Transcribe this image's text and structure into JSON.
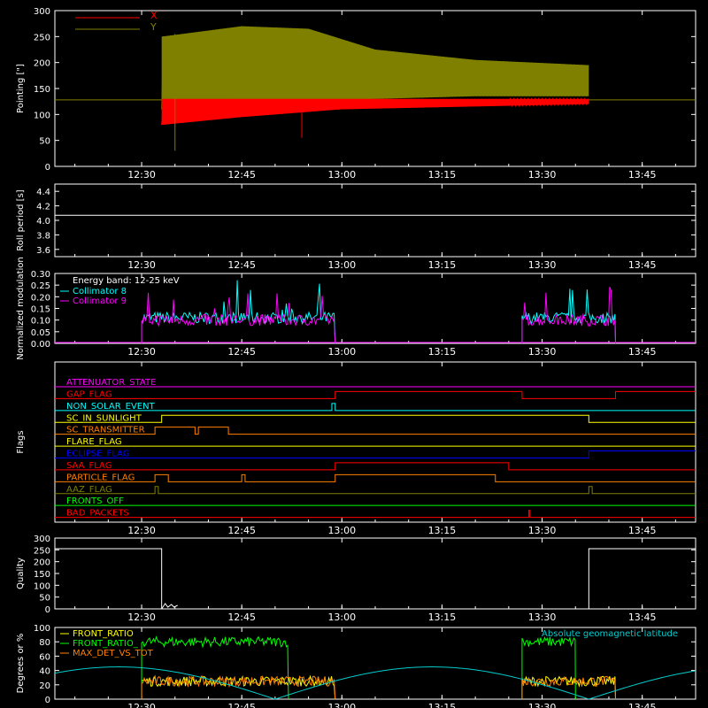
{
  "time_ticks": [
    "12:30",
    "12:45",
    "13:00",
    "13:15",
    "13:30",
    "13:45"
  ],
  "chart_data": [
    {
      "type": "line",
      "ylabel": "Pointing [\"]",
      "ylim": [
        0,
        300
      ],
      "yticks": [
        "0",
        "50",
        "100",
        "150",
        "200",
        "250",
        "300"
      ],
      "series": [
        {
          "name": "X",
          "color": "#ff0000",
          "data": [
            [
              "12:33",
              95
            ],
            [
              "12:45",
              110
            ],
            [
              "12:57",
              115
            ],
            [
              "13:10",
              125
            ],
            [
              "13:25",
              130
            ],
            [
              "13:37",
              130
            ]
          ],
          "band": [
            [
              "12:33",
              80,
              130
            ],
            [
              "12:45",
              95,
              130
            ],
            [
              "13:00",
              110,
              130
            ],
            [
              "13:37",
              120,
              130
            ]
          ]
        },
        {
          "name": "Y",
          "color": "#808000",
          "data": [
            [
              "12:33",
              180
            ],
            [
              "12:45",
              200
            ],
            [
              "12:57",
              195
            ],
            [
              "13:10",
              170
            ],
            [
              "13:25",
              160
            ],
            [
              "13:37",
              160
            ]
          ],
          "band": [
            [
              "12:33",
              110,
              250
            ],
            [
              "12:45",
              120,
              270
            ],
            [
              "12:55",
              125,
              265
            ],
            [
              "13:05",
              130,
              225
            ],
            [
              "13:20",
              135,
              205
            ],
            [
              "13:37",
              135,
              195
            ]
          ]
        }
      ],
      "reference_line": 128,
      "legend": "top-left"
    },
    {
      "type": "line",
      "ylabel": "Roll period [s]",
      "ylim": [
        3.5,
        4.5
      ],
      "yticks": [
        "3.6",
        "3.8",
        "4.0",
        "4.2",
        "4.4"
      ],
      "series": [
        {
          "name": "",
          "color": "#ffffff",
          "data": [
            [
              "12:17",
              4.07
            ],
            [
              "13:53",
              4.07
            ]
          ]
        }
      ]
    },
    {
      "type": "line",
      "ylabel": "Normalized modulation",
      "ylim": [
        0,
        0.3
      ],
      "yticks": [
        "0.00",
        "0.05",
        "0.10",
        "0.15",
        "0.20",
        "0.25",
        "0.30"
      ],
      "annotation": "Energy band: 12-25 keV",
      "series": [
        {
          "name": "Collimator 8",
          "color": "#00ffff",
          "segments": [
            [
              "12:30",
              "12:59"
            ],
            [
              "13:27",
              "13:41"
            ]
          ],
          "level": 0.11
        },
        {
          "name": "Collimator 9",
          "color": "#ff00ff",
          "segments": [
            [
              "12:30",
              "12:59"
            ],
            [
              "13:27",
              "13:41"
            ]
          ],
          "level": 0.1
        }
      ],
      "legend": "top-left"
    },
    {
      "type": "line",
      "ylabel": "Flags",
      "series": [
        {
          "name": "ATTENUATOR_STATE",
          "color": "#ff00ff",
          "changes": []
        },
        {
          "name": "GAP_FLAG",
          "color": "#ff0000",
          "changes": [
            [
              "12:59",
              1
            ],
            [
              "13:27",
              0
            ],
            [
              "13:41",
              1
            ]
          ]
        },
        {
          "name": "NON_SOLAR_EVENT",
          "color": "#00ffff",
          "changes": [
            [
              "12:58:30",
              1
            ],
            [
              "12:59:00",
              0
            ]
          ]
        },
        {
          "name": "SC_IN_SUNLIGHT",
          "color": "#ffff00",
          "changes": [
            [
              "12:33",
              1
            ],
            [
              "13:37",
              0
            ]
          ]
        },
        {
          "name": "SC_TRANSMITTER",
          "color": "#ff8000",
          "changes": [
            [
              "12:32",
              1
            ],
            [
              "12:38",
              0
            ],
            [
              "12:38:30",
              1
            ],
            [
              "12:43",
              0
            ]
          ]
        },
        {
          "name": "FLARE_FLAG",
          "color": "#ffff00",
          "changes": []
        },
        {
          "name": "ECLIPSE_FLAG",
          "color": "#0000ff",
          "changes": [
            [
              "12:33",
              0
            ],
            [
              "13:37",
              1
            ]
          ]
        },
        {
          "name": "SAA_FLAG",
          "color": "#ff0000",
          "changes": [
            [
              "12:59",
              1
            ],
            [
              "13:25",
              0
            ]
          ]
        },
        {
          "name": "PARTICLE_FLAG",
          "color": "#ff8000",
          "changes": [
            [
              "12:32",
              1
            ],
            [
              "12:34",
              0
            ],
            [
              "12:45",
              1
            ],
            [
              "12:45:30",
              0
            ],
            [
              "12:59",
              1
            ],
            [
              "13:23",
              0
            ]
          ]
        },
        {
          "name": "AAZ_FLAG",
          "color": "#808000",
          "changes": [
            [
              "12:32",
              1
            ],
            [
              "12:32:30",
              0
            ],
            [
              "13:37",
              1
            ],
            [
              "13:37:30",
              0
            ]
          ]
        },
        {
          "name": "FRONTS_OFF",
          "color": "#00ff00",
          "changes": []
        },
        {
          "name": "BAD_PACKETS",
          "color": "#ff0000",
          "changes": [
            [
              "13:28",
              1
            ],
            [
              "13:28:10",
              0
            ]
          ]
        }
      ]
    },
    {
      "type": "line",
      "ylabel": "Quality",
      "ylim": [
        0,
        300
      ],
      "yticks": [
        "0",
        "50",
        "100",
        "150",
        "200",
        "250",
        "300"
      ],
      "series": [
        {
          "name": "",
          "color": "#ffffff",
          "data": [
            [
              "12:17",
              255
            ],
            [
              "12:33",
              255
            ],
            [
              "12:33",
              0
            ],
            [
              "13:37",
              0
            ],
            [
              "13:37",
              255
            ],
            [
              "13:53",
              255
            ]
          ]
        }
      ]
    },
    {
      "type": "line",
      "ylabel": "Degrees or %",
      "ylim": [
        0,
        100
      ],
      "yticks": [
        "0",
        "20",
        "40",
        "60",
        "80",
        "100"
      ],
      "series": [
        {
          "name": "FRONT_RATIO",
          "color": "#ffff00",
          "segments": [
            [
              "12:30",
              "12:59"
            ],
            [
              "13:27",
              "13:41"
            ]
          ],
          "level": 25
        },
        {
          "name": "FRONT_RATIO_",
          "color": "#00ff00",
          "segments": [
            [
              "12:30",
              "12:52"
            ],
            [
              "13:27",
              "13:35"
            ]
          ],
          "level": 80
        },
        {
          "name": "MAX_DET_VS_TOT",
          "color": "#ff8000",
          "segments": [
            [
              "12:30",
              "12:59"
            ],
            [
              "13:27",
              "13:41"
            ]
          ],
          "level": 25
        },
        {
          "name": "Absolute geomagnetic latitude",
          "color": "#00cccc",
          "latitude": true
        }
      ],
      "legend": "top-left"
    }
  ],
  "colors": {
    "axes": "#ffffff",
    "background": "#000000"
  }
}
